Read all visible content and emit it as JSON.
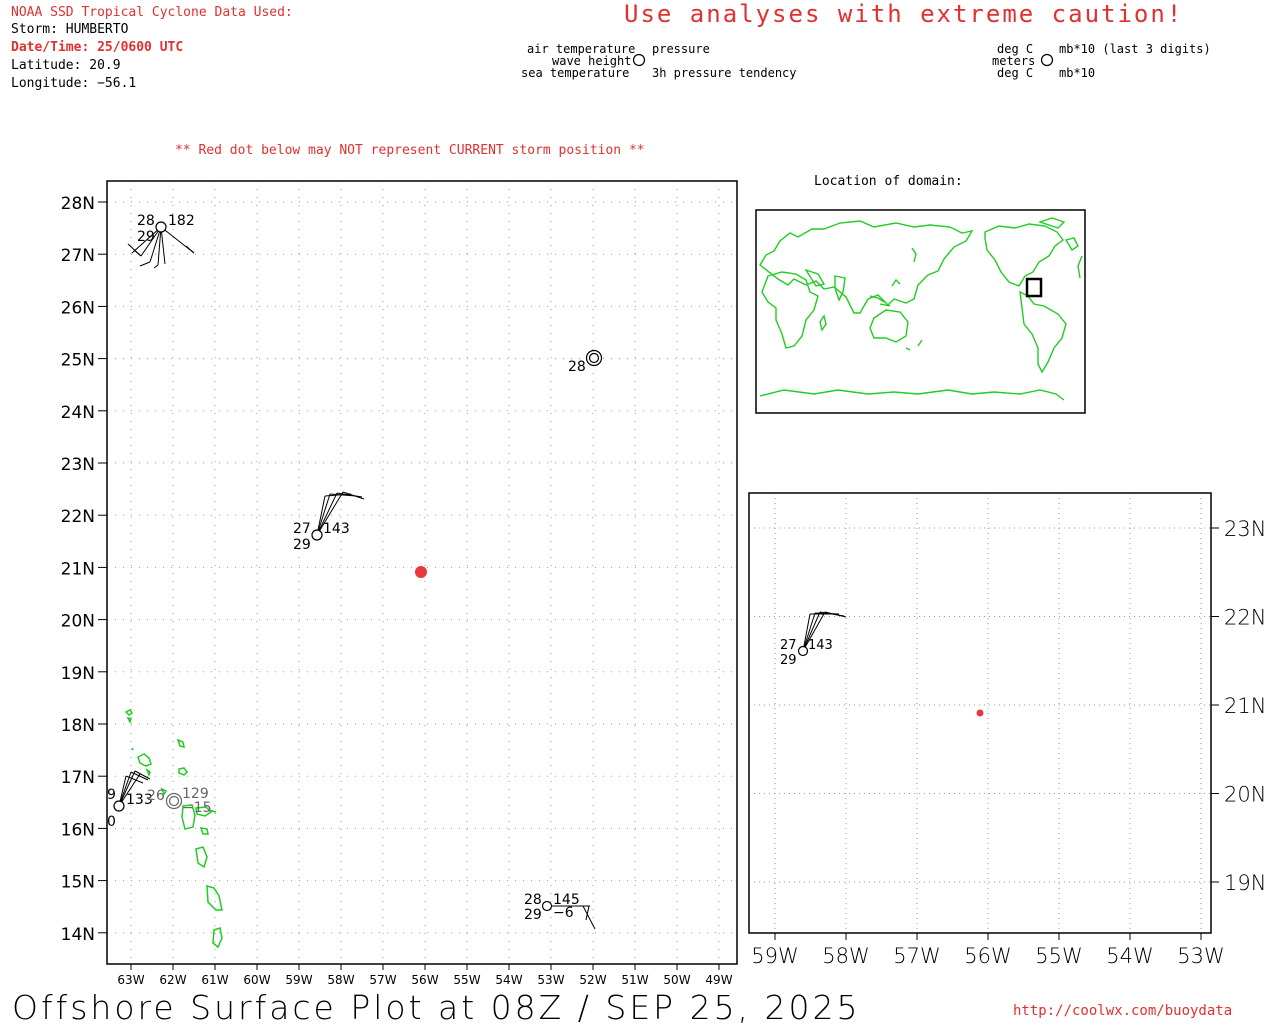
{
  "header": {
    "source_label": "NOAA SSD Tropical Cyclone Data Used:",
    "storm": "Storm: HUMBERTO",
    "datetime": "Date/Time: 25/0600 UTC",
    "latitude": "Latitude: 20.9",
    "longitude": "Longitude: −56.1",
    "caution": "Use analyses with extreme caution!",
    "red_dot_note": "** Red dot below may NOT represent CURRENT storm position **"
  },
  "legend": {
    "air_temperature": "air temperature",
    "wave_height": "wave height",
    "sea_temperature": "sea temperature",
    "pressure": "pressure",
    "pressure_tendency": "3h pressure tendency",
    "deg_c_top": "deg C",
    "meters": "meters",
    "deg_c_bottom": "deg C",
    "mb_last3": "mb*10 (last 3 digits)",
    "mb10": "mb*10"
  },
  "inset_title": "Location of domain:",
  "main_map": {
    "lat_labels": [
      "28N",
      "27N",
      "26N",
      "25N",
      "24N",
      "23N",
      "22N",
      "21N",
      "20N",
      "19N",
      "18N",
      "17N",
      "16N",
      "15N",
      "14N"
    ],
    "lon_labels": [
      "63W",
      "62W",
      "61W",
      "60W",
      "59W",
      "58W",
      "57W",
      "56W",
      "55W",
      "54W",
      "53W",
      "52W",
      "51W",
      "50W",
      "49W"
    ],
    "storm_position": {
      "lat": 20.9,
      "lon": -56.1,
      "color": "#e8383d"
    },
    "stations": [
      {
        "id": "stn-nw",
        "lat": 27.5,
        "lon": -62.3,
        "air_temp": "28",
        "sea_temp": "29",
        "pressure": "182"
      },
      {
        "id": "stn-ne",
        "lat": 25.0,
        "lon": -52.0,
        "air_temp": "28"
      },
      {
        "id": "stn-center",
        "lat": 21.6,
        "lon": -58.6,
        "air_temp": "27",
        "sea_temp": "29",
        "pressure": "143"
      },
      {
        "id": "stn-west",
        "lat": 16.4,
        "lon": -63.3,
        "air_temp": "9",
        "sea_temp": "0",
        "pressure": "133"
      },
      {
        "id": "stn-west2",
        "lat": 16.5,
        "lon": -62.0,
        "air_temp": "26",
        "pressure": "129",
        "tendency": "−15"
      },
      {
        "id": "stn-south",
        "lat": 14.5,
        "lon": -53.2,
        "air_temp": "28",
        "sea_temp": "29",
        "pressure": "145",
        "tendency": "−6"
      }
    ]
  },
  "zoom_map": {
    "lat_labels": [
      "23N",
      "22N",
      "21N",
      "20N",
      "19N"
    ],
    "lon_labels": [
      "59W",
      "58W",
      "57W",
      "56W",
      "55W",
      "54W",
      "53W"
    ],
    "station": {
      "air_temp": "27",
      "sea_temp": "29",
      "pressure": "143"
    }
  },
  "footer": {
    "title": "Offshore Surface Plot at 08Z / SEP 25, 2025",
    "url": "http://coolwx.com/buoydata"
  },
  "colors": {
    "land": "#22cc22",
    "accent_red": "#e03030",
    "grid": "#999999"
  }
}
